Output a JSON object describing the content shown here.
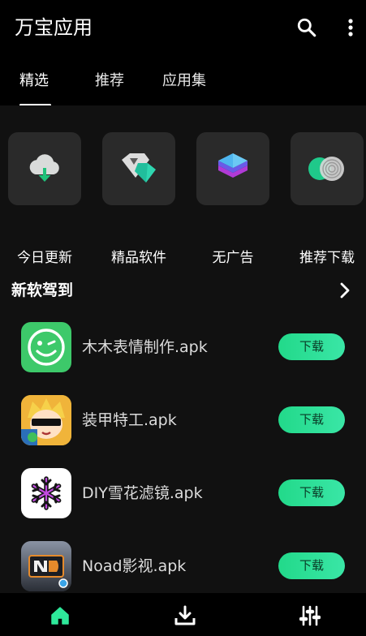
{
  "header": {
    "title": "万宝应用",
    "icons": [
      "search-icon",
      "more-vertical-icon"
    ]
  },
  "tabs": [
    {
      "label": "精选",
      "active": true
    },
    {
      "label": "推荐",
      "active": false
    },
    {
      "label": "应用集",
      "active": false
    }
  ],
  "categories": [
    {
      "label": "今日更新",
      "icon": "cloud-download-icon"
    },
    {
      "label": "精品软件",
      "icon": "diamond-icon"
    },
    {
      "label": "无广告",
      "icon": "layers-icon"
    },
    {
      "label": "推荐下载",
      "icon": "target-rings-icon"
    }
  ],
  "section": {
    "title": "新软驾到",
    "arrow_icon": "chevron-right-icon"
  },
  "apps": [
    {
      "name": "木木表情制作.apk",
      "button": "下载",
      "icon": "wink-face-icon"
    },
    {
      "name": "装甲特工.apk",
      "button": "下载",
      "icon": "game-character-icon"
    },
    {
      "name": "DIY雪花滤镜.apk",
      "button": "下载",
      "icon": "snowflake-icon"
    },
    {
      "name": "Noad影视.apk",
      "button": "下载",
      "icon": "video-app-icon"
    }
  ],
  "bottom_nav": [
    {
      "icon": "home-icon",
      "active": true
    },
    {
      "icon": "download-icon",
      "active": false
    },
    {
      "icon": "equalizer-icon",
      "active": false
    }
  ],
  "colors": {
    "accent": "#2ee89a",
    "background": "#111111",
    "tile": "#2a2a2a"
  }
}
